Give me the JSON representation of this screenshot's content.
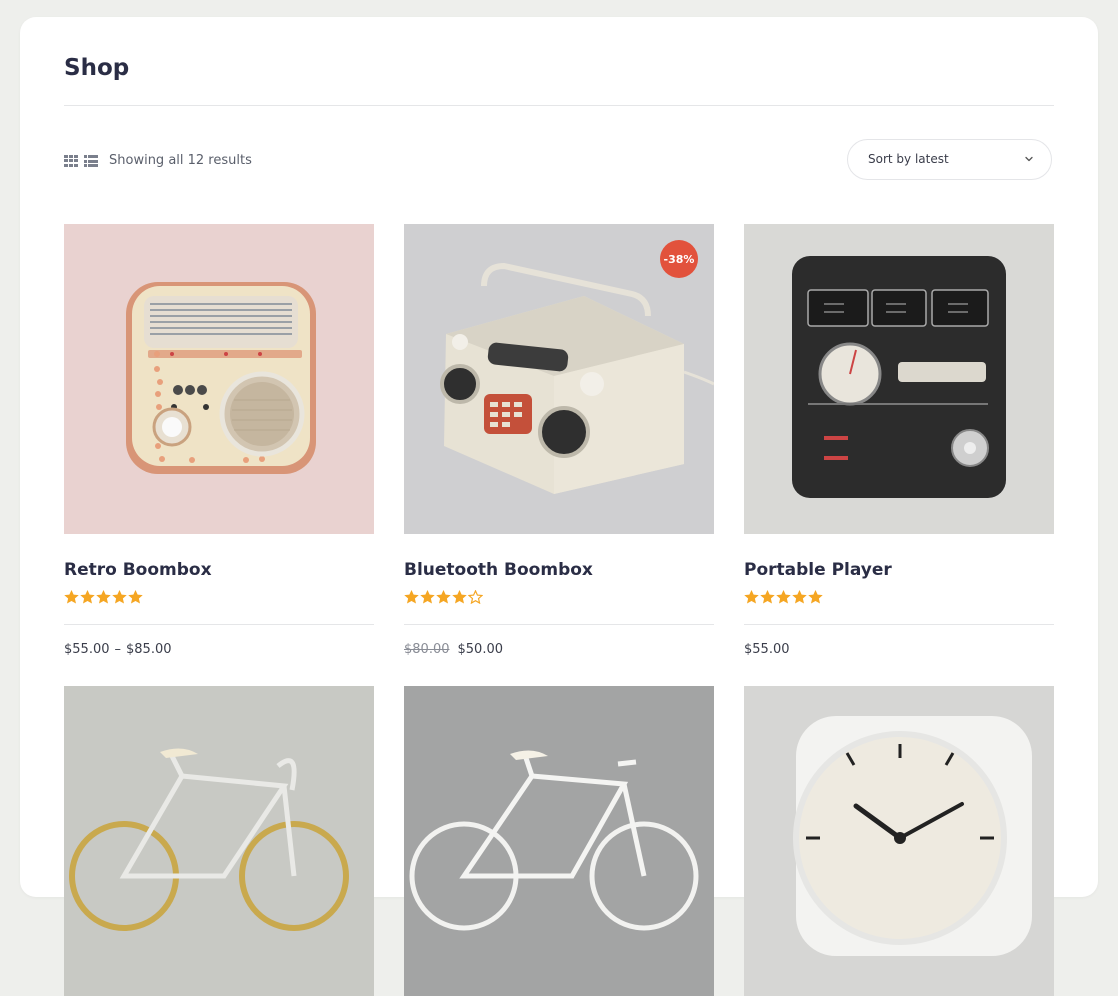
{
  "page": {
    "title": "Shop"
  },
  "toolbar": {
    "grid_icon": "grid-view-icon",
    "list_icon": "list-view-icon",
    "result_count": "Showing all 12 results",
    "sort_selected": "Sort by latest",
    "sort_icon": "chevron-down-icon"
  },
  "colors": {
    "accent_star": "#f5a623",
    "sale_badge": "#e2523c",
    "heading": "#2a2d45"
  },
  "products": [
    {
      "name": "Retro Boombox",
      "rating": 5,
      "price_min": "$55.00",
      "price_sep": "–",
      "price_max": "$85.00"
    },
    {
      "name": "Bluetooth Boombox",
      "rating": 4,
      "badge": "-38%",
      "price_old": "$80.00",
      "price": "$50.00"
    },
    {
      "name": "Portable Player",
      "rating": 5,
      "price": "$55.00"
    },
    {
      "name": "",
      "rating": null
    },
    {
      "name": "",
      "rating": null
    },
    {
      "name": "",
      "rating": null
    }
  ]
}
